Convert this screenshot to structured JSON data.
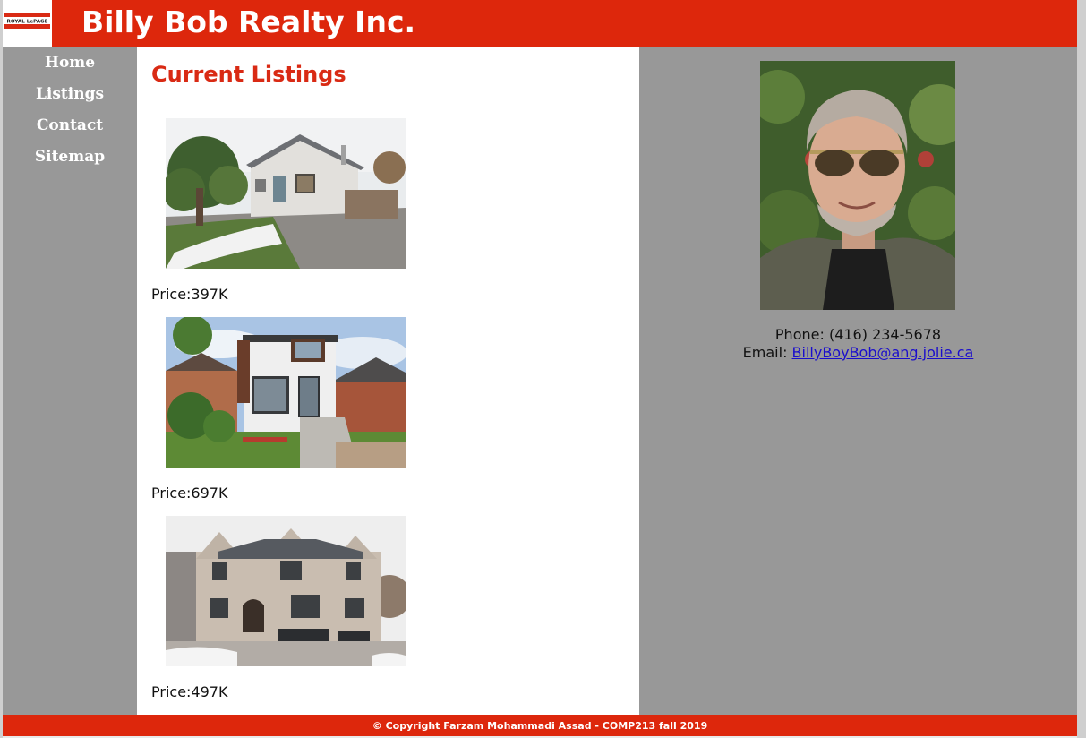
{
  "header": {
    "title": "Billy Bob Realty Inc.",
    "logo_text": "ROYAL LePAGE",
    "logo_icon": "royal-lepage-logo"
  },
  "nav": {
    "items": [
      {
        "label": "Home"
      },
      {
        "label": "Listings"
      },
      {
        "label": "Contact"
      },
      {
        "label": "Sitemap"
      }
    ]
  },
  "main": {
    "title": "Current Listings",
    "listings": [
      {
        "price_label": "Price:",
        "price": "397K",
        "photo": "bungalow-house-photo"
      },
      {
        "price_label": "Price:",
        "price": "697K",
        "photo": "modern-house-photo"
      },
      {
        "price_label": "Price:",
        "price": "497K",
        "photo": "stone-mansion-photo"
      }
    ]
  },
  "aside": {
    "agent_photo": "agent-portrait-photo",
    "phone_label": "Phone:",
    "phone": "(416) 234-5678",
    "email_label": "Email:",
    "email": "BillyBoyBob@ang.jolie.ca"
  },
  "footer": {
    "text": "© Copyright Farzam Mohammadi Assad - COMP213 fall 2019"
  },
  "colors": {
    "brand_red": "#dd270c",
    "title_red": "#d92a14",
    "sidebar_gray": "#989898",
    "link_blue": "#1a0dcc"
  }
}
